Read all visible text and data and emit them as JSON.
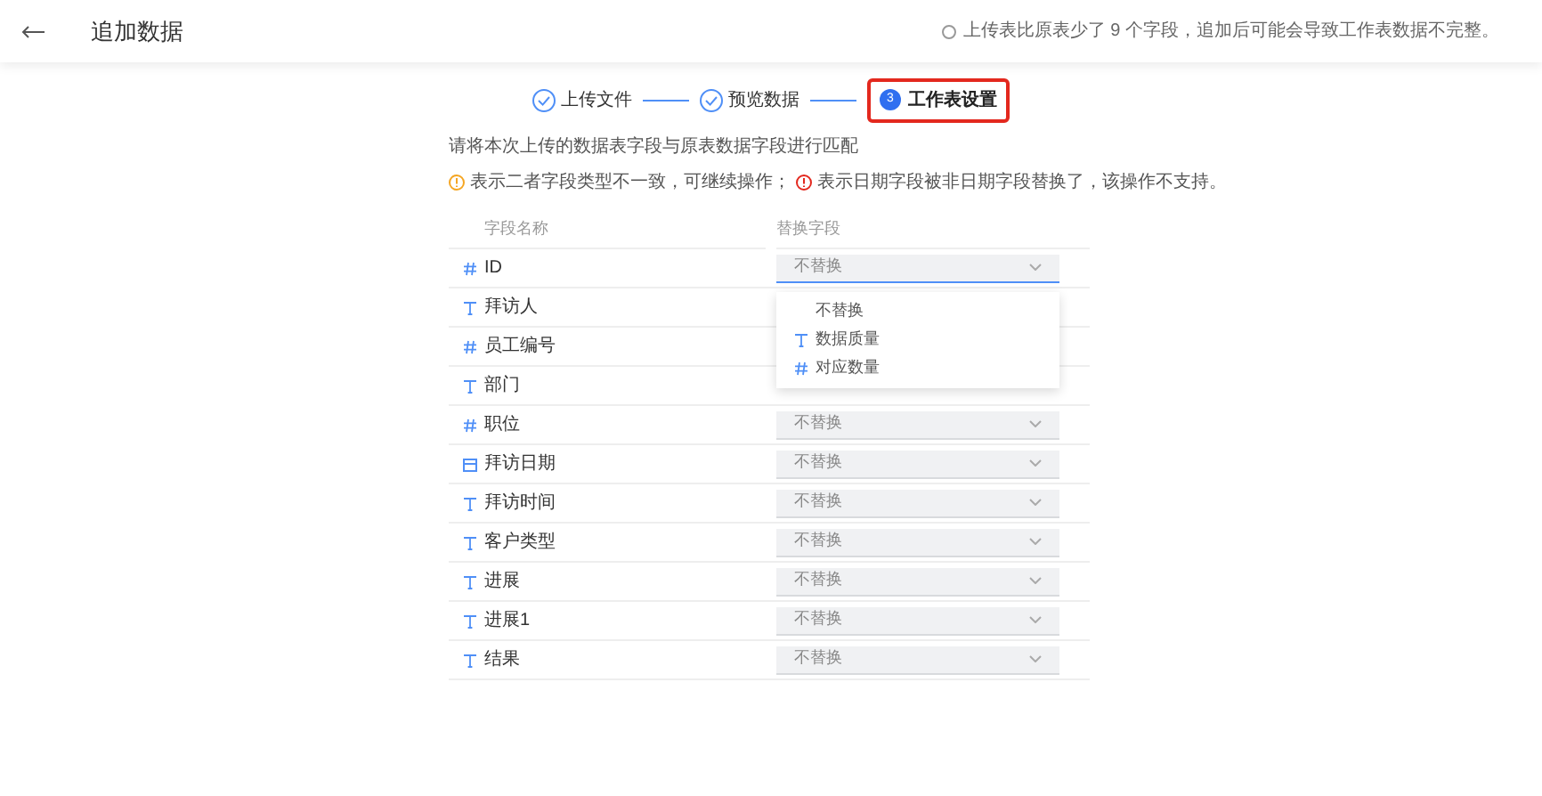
{
  "header": {
    "title": "追加数据",
    "notice": "上传表比原表少了 9 个字段，追加后可能会导致工作表数据不完整。"
  },
  "steps": [
    {
      "label": "上传文件",
      "kind": "done"
    },
    {
      "label": "预览数据",
      "kind": "done"
    },
    {
      "label": "工作表设置",
      "kind": "current",
      "number": "3"
    }
  ],
  "instruction": "请将本次上传的数据表字段与原表数据字段进行匹配",
  "legend": [
    {
      "kind": "warning",
      "text": "表示二者字段类型不一致，可继续操作；"
    },
    {
      "kind": "error",
      "text": "表示日期字段被非日期字段替换了，该操作不支持。"
    }
  ],
  "table": {
    "columns": [
      "字段名称",
      "替换字段"
    ],
    "rows": [
      {
        "kind": "number",
        "name": "ID",
        "replace": "不替换",
        "open": true
      },
      {
        "kind": "text",
        "name": "拜访人"
      },
      {
        "kind": "number",
        "name": "员工编号"
      },
      {
        "kind": "text",
        "name": "部门"
      },
      {
        "kind": "number",
        "name": "职位",
        "replace": "不替换",
        "open": false
      },
      {
        "kind": "date",
        "name": "拜访日期",
        "replace": "不替换",
        "open": false
      },
      {
        "kind": "text",
        "name": "拜访时间",
        "replace": "不替换",
        "open": false
      },
      {
        "kind": "text",
        "name": "客户类型",
        "replace": "不替换",
        "open": false
      },
      {
        "kind": "text",
        "name": "进展",
        "replace": "不替换",
        "open": false
      },
      {
        "kind": "text",
        "name": "进展1",
        "replace": "不替换",
        "open": false
      },
      {
        "kind": "text",
        "name": "结果",
        "replace": "不替换",
        "open": false
      }
    ]
  },
  "dropdown": {
    "options": [
      {
        "kind": "none",
        "label": "不替换"
      },
      {
        "kind": "text",
        "label": "数据质量"
      },
      {
        "kind": "number",
        "label": "对应数量"
      }
    ]
  }
}
